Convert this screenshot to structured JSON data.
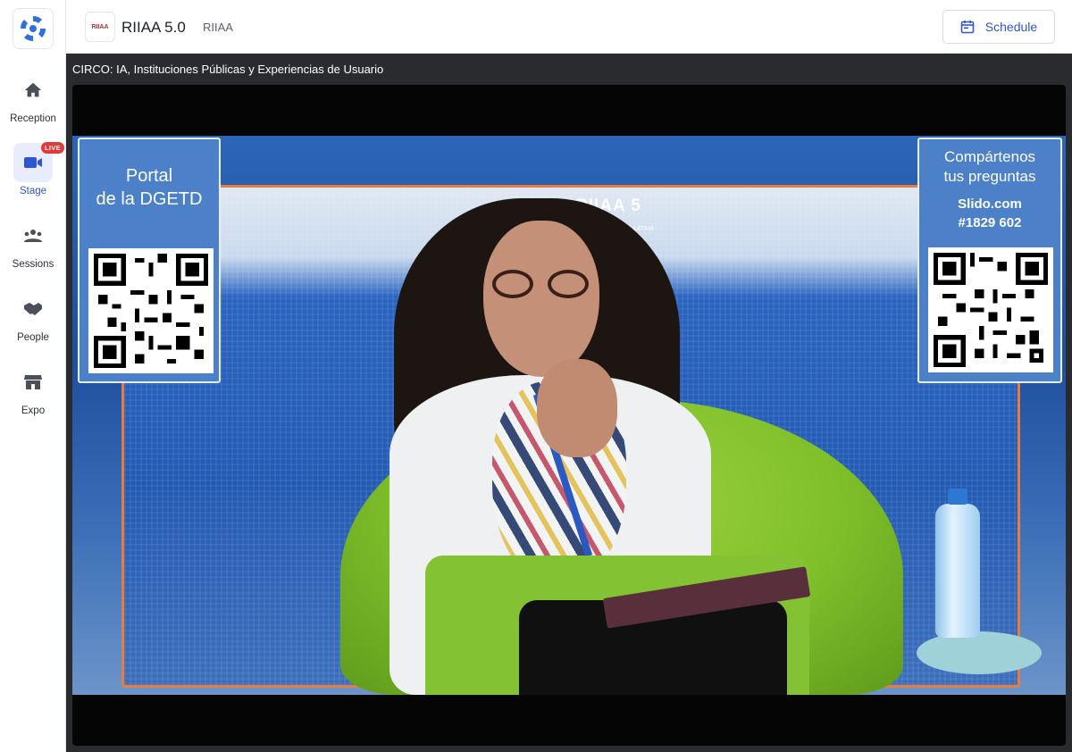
{
  "sidebar": {
    "items": [
      {
        "label": "Reception",
        "icon": "home-icon"
      },
      {
        "label": "Stage",
        "icon": "video-camera-icon",
        "badge": "LIVE",
        "active": true
      },
      {
        "label": "Sessions",
        "icon": "people-group-icon"
      },
      {
        "label": "People",
        "icon": "handshake-icon"
      },
      {
        "label": "Expo",
        "icon": "storefront-icon"
      }
    ]
  },
  "header": {
    "event_title": "RIIAA 5.0",
    "organizer": "RIIAA",
    "logo_text": "RIIAA",
    "schedule_label": "Schedule"
  },
  "stage": {
    "title": "CIRCO: IA, Instituciones Públicas y Experiencias de Usuario"
  },
  "video": {
    "brand_text": "RIIAA 5",
    "brand_sub": "LATAM",
    "left_card": {
      "line1": "Portal",
      "line2": "de la DGETD"
    },
    "right_card": {
      "line1": "Compártenos",
      "line2": "tus preguntas",
      "line3": "Slido.com",
      "line4": "#1829 602"
    }
  },
  "colors": {
    "accent": "#2f55d4",
    "live_badge": "#e23a3a",
    "stage_bg": "#2a2b2f"
  }
}
